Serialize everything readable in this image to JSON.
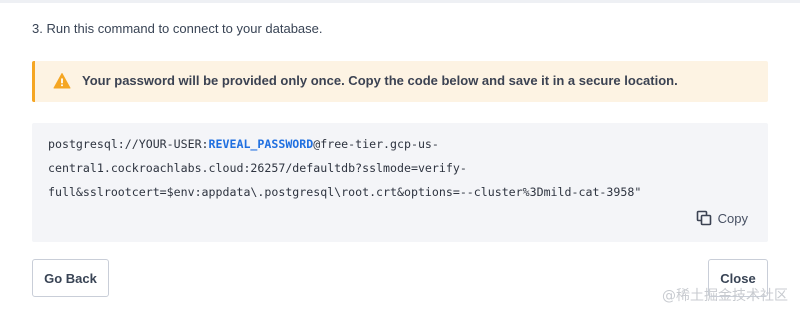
{
  "step": {
    "text": "3. Run this command to connect to your database."
  },
  "warning": {
    "icon": "warning-icon",
    "color": "#f5a623",
    "text": "Your password will be provided only once. Copy the code below and save it in a secure location."
  },
  "connection": {
    "line1_prefix": "postgresql://YOUR-USER:",
    "reveal_label": "REVEAL_PASSWORD",
    "line1_suffix": "@free-tier.gcp-us-",
    "line2": "central1.cockroachlabs.cloud:26257/defaultdb?sslmode=verify-",
    "line3": "full&sslrootcert=$env:appdata\\.postgresql\\root.crt&options=--cluster%3Dmild-cat-3958\"",
    "link_color": "#1f6fe0"
  },
  "copy": {
    "icon": "copy-icon",
    "label": "Copy"
  },
  "buttons": {
    "back_label": "Go Back",
    "close_label": "Close"
  },
  "watermark": {
    "text": "@稀土掘金技术社区"
  }
}
